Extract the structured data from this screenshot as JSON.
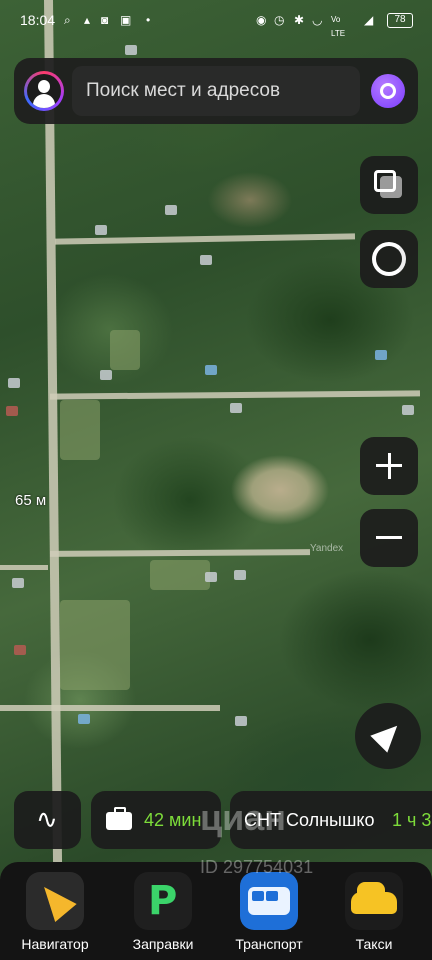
{
  "status_bar": {
    "time": "18:04",
    "battery": "78",
    "left_icons": [
      "search-icon",
      "bell-icon",
      "message-icon",
      "gallery-icon",
      "dot-icon"
    ],
    "right_icons": [
      "location-icon",
      "alarm-icon",
      "bluetooth-icon",
      "wifi-icon",
      "volte-icon",
      "signal-icon"
    ]
  },
  "search": {
    "placeholder": "Поиск мест и адресов"
  },
  "map": {
    "scale_label": "65 м",
    "watermark": "Yandex"
  },
  "route_row": {
    "work_time": "42 мин",
    "place_name": "СНТ Солнышко",
    "place_time": "1 ч 3"
  },
  "dock": {
    "items": [
      {
        "label": "Навигатор",
        "icon": "navigator-arrow-icon"
      },
      {
        "label": "Заправки",
        "icon": "fuel-p-icon"
      },
      {
        "label": "Транспорт",
        "icon": "bus-icon"
      },
      {
        "label": "Такси",
        "icon": "taxi-car-icon"
      }
    ]
  },
  "overlay": {
    "brand": "циан",
    "listing_id": "ID 297754031"
  },
  "colors": {
    "accent_green": "#7ddc3a",
    "alice_purple": "#7a3cff",
    "panel_dark": "#1c1c1c"
  }
}
